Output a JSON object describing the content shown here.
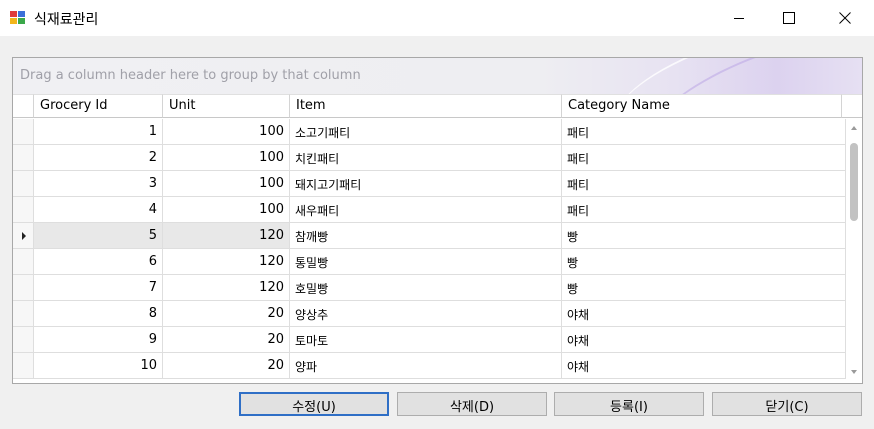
{
  "window": {
    "title": "식재료관리"
  },
  "grid": {
    "group_panel_text": "Drag a column header here to group by that column",
    "columns": [
      "Grocery Id",
      "Unit",
      "Item",
      "Category Name"
    ],
    "focused_row": 4,
    "rows": [
      {
        "id": "1",
        "unit": "100",
        "item": "소고기패티",
        "category": "패티"
      },
      {
        "id": "2",
        "unit": "100",
        "item": "치킨패티",
        "category": "패티"
      },
      {
        "id": "3",
        "unit": "100",
        "item": "돼지고기패티",
        "category": "패티"
      },
      {
        "id": "4",
        "unit": "100",
        "item": "새우패티",
        "category": "패티"
      },
      {
        "id": "5",
        "unit": "120",
        "item": "참깨빵",
        "category": "빵"
      },
      {
        "id": "6",
        "unit": "120",
        "item": "통밀빵",
        "category": "빵"
      },
      {
        "id": "7",
        "unit": "120",
        "item": "호밀빵",
        "category": "빵"
      },
      {
        "id": "8",
        "unit": "20",
        "item": "양상추",
        "category": "야채"
      },
      {
        "id": "9",
        "unit": "20",
        "item": "토마토",
        "category": "야채"
      },
      {
        "id": "10",
        "unit": "20",
        "item": "양파",
        "category": "야채"
      }
    ]
  },
  "buttons": {
    "edit": "수정(U)",
    "delete": "삭제(D)",
    "register": "등록(I)",
    "close": "닫기(C)"
  },
  "colors": {
    "accent": "#2f6fc6",
    "grid_border": "#a8a8a8",
    "group_panel_text": "#a0a0a8"
  }
}
